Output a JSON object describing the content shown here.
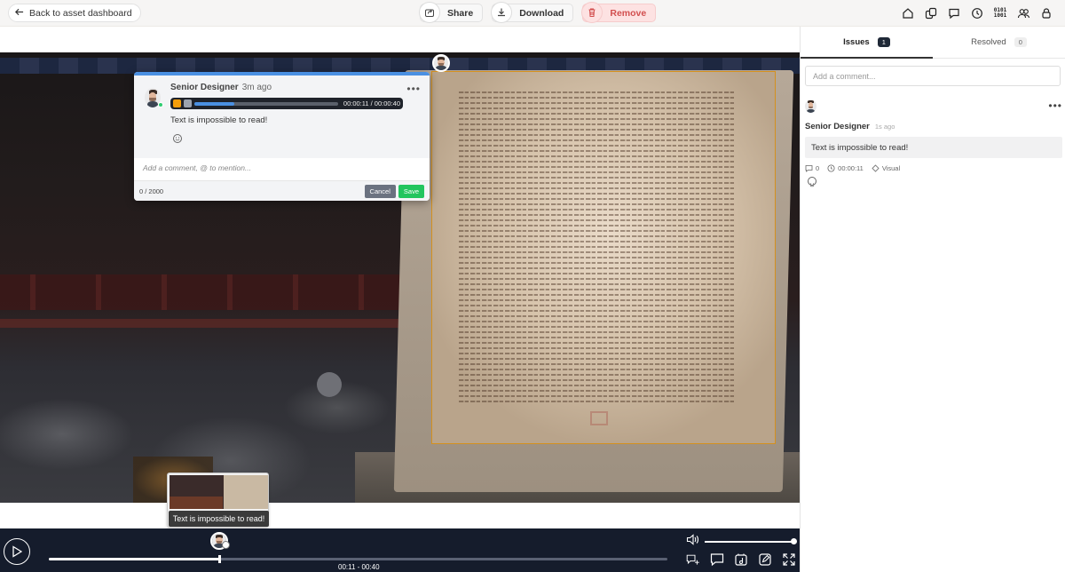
{
  "topbar": {
    "back_label": "Back to asset dashboard",
    "share_label": "Share",
    "download_label": "Download",
    "remove_label": "Remove",
    "binary_icon_text": "0101\n1001"
  },
  "popup": {
    "author": "Senior Designer",
    "time_ago": "3m ago",
    "audio_time": "00:00:11 / 00:00:40",
    "audio_progress": 0.28,
    "comment": "Text is impossible to read!",
    "reply_placeholder": "Add a comment, @ to mention...",
    "char_count": "0 / 2000",
    "cancel_label": "Cancel",
    "save_label": "Save"
  },
  "hover_card": {
    "tooltip": "Text is impossible to read!"
  },
  "player": {
    "time": "00:11 - 00:40",
    "played_fraction": 0.275,
    "volume_fraction": 1.0
  },
  "panel": {
    "tabs": [
      {
        "label": "Issues",
        "count": "1"
      },
      {
        "label": "Resolved",
        "count": "0"
      }
    ],
    "comment_placeholder": "Add a comment...",
    "issue": {
      "author": "Senior Designer",
      "time_ago": "1s ago",
      "text": "Text is impossible to read!",
      "replies": "0",
      "timestamp": "00:00:11",
      "type": "Visual"
    }
  },
  "colors": {
    "accent": "#4a90e2",
    "annotation": "#d4901e",
    "save": "#22c55e",
    "remove": "#d24f4f",
    "player_bg": "#151c2c"
  }
}
